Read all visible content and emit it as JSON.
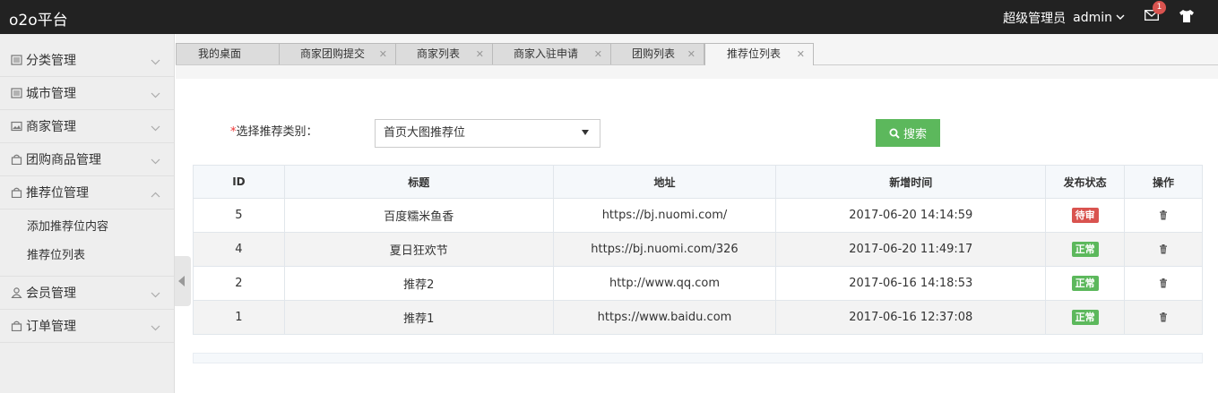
{
  "header": {
    "brand": "o2o平台",
    "role": "超级管理员",
    "username": "admin",
    "mail_badge": "1"
  },
  "sidebar": {
    "items": [
      {
        "label": "分类管理",
        "icon": "list-icon",
        "expanded": false
      },
      {
        "label": "城市管理",
        "icon": "list-icon",
        "expanded": false
      },
      {
        "label": "商家管理",
        "icon": "picture-icon",
        "expanded": false
      },
      {
        "label": "团购商品管理",
        "icon": "bag-icon",
        "expanded": false
      },
      {
        "label": "推荐位管理",
        "icon": "bag-icon",
        "expanded": true,
        "children": [
          "添加推荐位内容",
          "推荐位列表"
        ]
      },
      {
        "label": "会员管理",
        "icon": "user-icon",
        "expanded": false
      },
      {
        "label": "订单管理",
        "icon": "bag-icon",
        "expanded": false
      }
    ]
  },
  "tabs": [
    {
      "label": "我的桌面",
      "closable": false
    },
    {
      "label": "商家团购提交",
      "closable": true
    },
    {
      "label": "商家列表",
      "closable": true
    },
    {
      "label": "商家入驻申请",
      "closable": true
    },
    {
      "label": "团购列表",
      "closable": true
    },
    {
      "label": "推荐位列表",
      "closable": true,
      "active": true
    }
  ],
  "filter": {
    "required_mark": "*",
    "label": "选择推荐类别：",
    "selected": "首页大图推荐位",
    "search_label": "搜索"
  },
  "table": {
    "headers": [
      "ID",
      "标题",
      "地址",
      "新增时间",
      "发布状态",
      "操作"
    ],
    "rows": [
      {
        "id": "5",
        "title": "百度糯米鱼香",
        "url": "https://bj.nuomi.com/",
        "time": "2017-06-20 14:14:59",
        "status": "待审",
        "status_color": "#d9534f"
      },
      {
        "id": "4",
        "title": "夏日狂欢节",
        "url": "https://bj.nuomi.com/326",
        "time": "2017-06-20 11:49:17",
        "status": "正常",
        "status_color": "#5cb85c"
      },
      {
        "id": "2",
        "title": "推荐2",
        "url": "http://www.qq.com",
        "time": "2017-06-16 14:18:53",
        "status": "正常",
        "status_color": "#5cb85c"
      },
      {
        "id": "1",
        "title": "推荐1",
        "url": "https://www.baidu.com",
        "time": "2017-06-16 12:37:08",
        "status": "正常",
        "status_color": "#5cb85c"
      }
    ]
  },
  "colors": {
    "topbar": "#222222",
    "accent_green": "#5cb85c",
    "danger_red": "#d9534f"
  }
}
